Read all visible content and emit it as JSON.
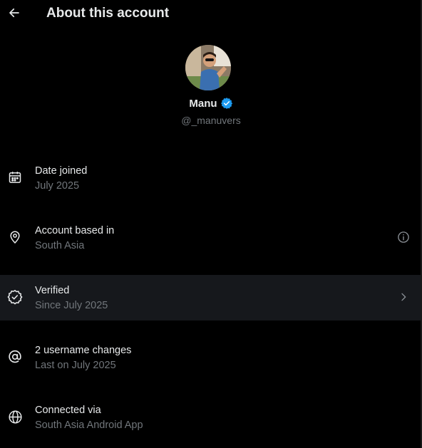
{
  "header": {
    "title": "About this account",
    "back_icon": "arrow-left-icon"
  },
  "profile": {
    "name": "Manu",
    "handle": "@_manuvers",
    "verified_badge_color": "#1d9bf0"
  },
  "rows": [
    {
      "icon": "calendar-icon",
      "label": "Date joined",
      "value": "July 2025"
    },
    {
      "icon": "location-pin-icon",
      "label": "Account based in",
      "value": "South Asia",
      "trailing_icon": "info-icon"
    },
    {
      "icon": "verified-check-icon",
      "label": "Verified",
      "value": "Since July 2025",
      "trailing_icon": "chevron-right-icon",
      "highlighted": true
    },
    {
      "icon": "at-sign-icon",
      "label": "2 username changes",
      "value": "Last on July 2025"
    },
    {
      "icon": "globe-icon",
      "label": "Connected via",
      "value": "South Asia Android App"
    }
  ],
  "colors": {
    "background": "#000000",
    "text_primary": "#e7e9ea",
    "text_secondary": "#71767b",
    "row_highlight": "#16181c"
  }
}
